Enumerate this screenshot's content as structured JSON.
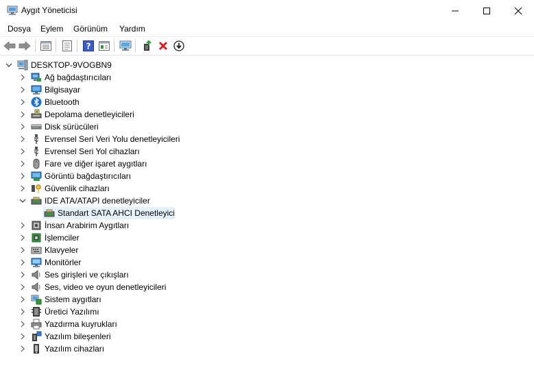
{
  "window": {
    "title": "Aygıt Yöneticisi"
  },
  "menu": [
    "Dosya",
    "Eylem",
    "Görünüm",
    "Yardım"
  ],
  "toolbar": {
    "buttons": [
      "back-arrow-icon",
      "forward-arrow-icon",
      "properties-list-icon",
      "details-page-icon",
      "help-icon",
      "view-icon",
      "monitor-scan-icon",
      "update-driver-icon",
      "uninstall-x-icon",
      "download-circle-icon"
    ]
  },
  "tree": {
    "root": "DESKTOP-9VOGBN9",
    "categories": [
      {
        "label": "Ağ bağdaştırıcıları",
        "icon": "network-adapter-icon",
        "expanded": false
      },
      {
        "label": "Bilgisayar",
        "icon": "computer-icon",
        "expanded": false
      },
      {
        "label": "Bluetooth",
        "icon": "bluetooth-icon",
        "expanded": false
      },
      {
        "label": "Depolama denetleyicileri",
        "icon": "storage-controller-icon",
        "expanded": false
      },
      {
        "label": "Disk sürücüleri",
        "icon": "disk-drive-icon",
        "expanded": false
      },
      {
        "label": "Evrensel Seri Veri Yolu denetleyicileri",
        "icon": "usb-icon",
        "expanded": false
      },
      {
        "label": "Evrensel Seri Yol cihazları",
        "icon": "usb-icon",
        "expanded": false
      },
      {
        "label": "Fare ve diğer işaret aygıtları",
        "icon": "mouse-icon",
        "expanded": false
      },
      {
        "label": "Görüntü bağdaştırıcıları",
        "icon": "display-adapter-icon",
        "expanded": false
      },
      {
        "label": "Güvenlik cihazları",
        "icon": "security-key-icon",
        "expanded": false
      },
      {
        "label": "IDE ATA/ATAPI denetleyiciler",
        "icon": "ide-controller-icon",
        "expanded": true,
        "children": [
          {
            "label": "Standart SATA AHCI Denetleyici",
            "icon": "ide-controller-icon",
            "selected": true
          }
        ]
      },
      {
        "label": "İnsan Arabirim Aygıtları",
        "icon": "hid-icon",
        "expanded": false
      },
      {
        "label": "İşlemciler",
        "icon": "processor-icon",
        "expanded": false
      },
      {
        "label": "Klavyeler",
        "icon": "keyboard-icon",
        "expanded": false
      },
      {
        "label": "Monitörler",
        "icon": "monitor-icon",
        "expanded": false
      },
      {
        "label": "Ses girişleri ve çıkışları",
        "icon": "speaker-icon",
        "expanded": false
      },
      {
        "label": "Ses, video ve oyun denetleyicileri",
        "icon": "speaker-icon",
        "expanded": false
      },
      {
        "label": "Sistem aygıtları",
        "icon": "system-devices-icon",
        "expanded": false
      },
      {
        "label": "Üretici Yazılımı",
        "icon": "firmware-icon",
        "expanded": false
      },
      {
        "label": "Yazdırma kuyrukları",
        "icon": "printer-icon",
        "expanded": false
      },
      {
        "label": "Yazılım bileşenleri",
        "icon": "software-component-icon",
        "expanded": false
      },
      {
        "label": "Yazılım cihazları",
        "icon": "software-device-icon",
        "expanded": false
      }
    ]
  },
  "colors": {
    "selection": "#e5f3ff",
    "accent_blue": "#1a73c9",
    "uninstall_red": "#d81e1e",
    "update_green": "#2e9b3b"
  }
}
